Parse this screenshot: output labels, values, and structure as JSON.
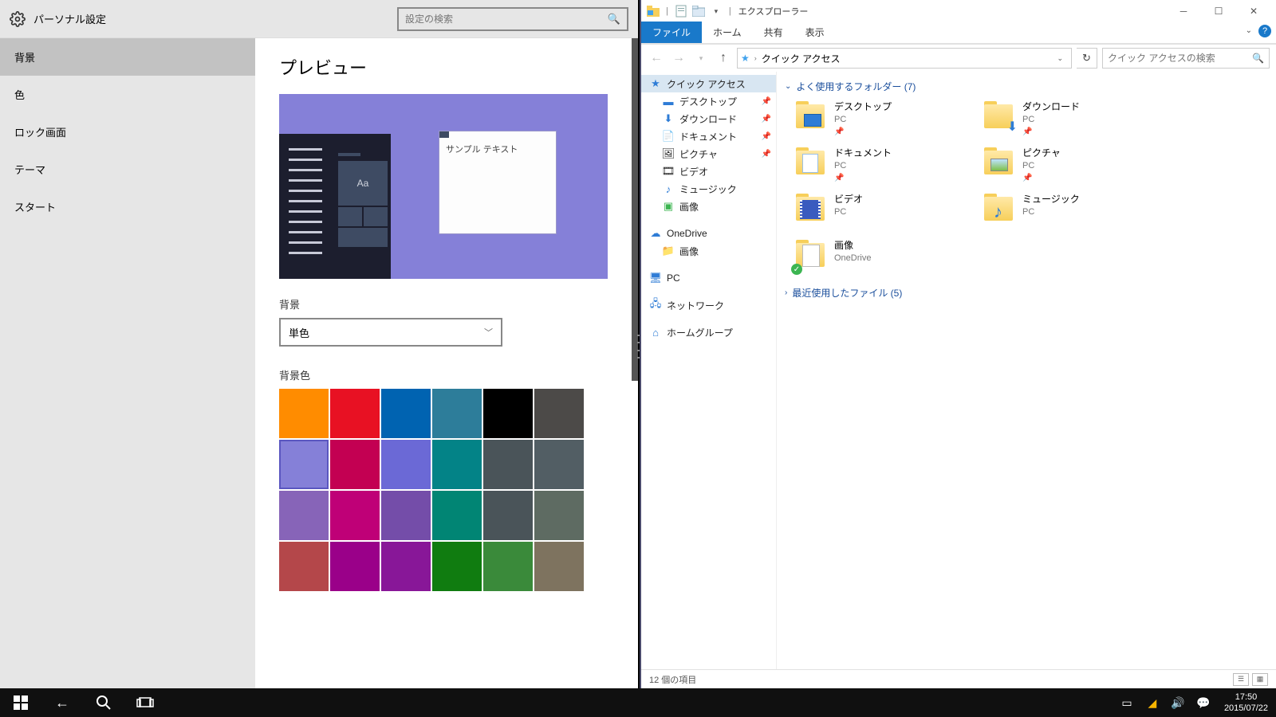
{
  "settings": {
    "title": "パーソナル設定",
    "search_placeholder": "設定の検索",
    "nav": [
      "背景",
      "色",
      "ロック画面",
      "テーマ",
      "スタート"
    ],
    "nav_active": 0,
    "preview_heading": "プレビュー",
    "sample_text": "サンプル テキスト",
    "preview_tile_label": "Aa",
    "bg_label": "背景",
    "bg_dropdown_value": "単色",
    "bgcolor_label": "背景色",
    "colors": [
      "#ff8c00",
      "#e81123",
      "#0063b1",
      "#2d7d9a",
      "#000000",
      "#4c4a48",
      "#8580d8",
      "#c30052",
      "#6b69d6",
      "#038387",
      "#4a5459",
      "#525e64",
      "#8764b8",
      "#bf0077",
      "#744da9",
      "#018574",
      "#4a5459",
      "#5e6b62",
      "#b4474a",
      "#9a0089",
      "#881798",
      "#107c10",
      "#3a8a3a",
      "#7e735f"
    ],
    "selected_color_index": 6
  },
  "explorer": {
    "title": "エクスプローラー",
    "tabs": {
      "file": "ファイル",
      "home": "ホーム",
      "share": "共有",
      "view": "表示"
    },
    "breadcrumb": "クイック アクセス",
    "search_placeholder": "クイック アクセスの検索",
    "tree": {
      "quick_access": "クイック アクセス",
      "desktop": "デスクトップ",
      "downloads": "ダウンロード",
      "documents": "ドキュメント",
      "pictures": "ピクチャ",
      "videos": "ビデオ",
      "music": "ミュージック",
      "images": "画像",
      "onedrive": "OneDrive",
      "onedrive_images": "画像",
      "pc": "PC",
      "network": "ネットワーク",
      "homegroup": "ホームグループ"
    },
    "groups": {
      "frequent": "よく使用するフォルダー (7)",
      "recent": "最近使用したファイル (5)"
    },
    "folders": [
      {
        "name": "デスクトップ",
        "loc": "PC",
        "pinned": true,
        "kind": "desktop"
      },
      {
        "name": "ダウンロード",
        "loc": "PC",
        "pinned": true,
        "kind": "download"
      },
      {
        "name": "ドキュメント",
        "loc": "PC",
        "pinned": true,
        "kind": "document"
      },
      {
        "name": "ピクチャ",
        "loc": "PC",
        "pinned": true,
        "kind": "picture"
      },
      {
        "name": "ビデオ",
        "loc": "PC",
        "pinned": false,
        "kind": "video"
      },
      {
        "name": "ミュージック",
        "loc": "PC",
        "pinned": false,
        "kind": "music"
      },
      {
        "name": "画像",
        "loc": "OneDrive",
        "pinned": false,
        "kind": "image"
      }
    ],
    "status": "12 個の項目"
  },
  "taskbar": {
    "time": "17:50",
    "date": "2015/07/22"
  }
}
